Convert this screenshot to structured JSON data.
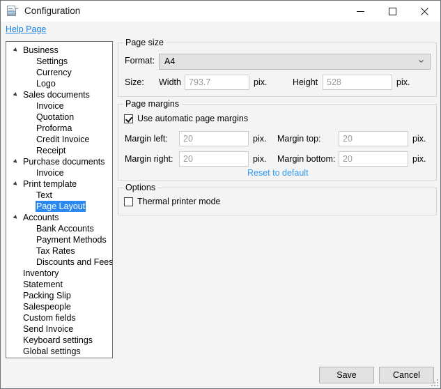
{
  "window": {
    "title": "Configuration",
    "icon": "document-spreadsheet-icon",
    "minimize_label": "Minimize",
    "maximize_label": "Maximize",
    "close_label": "Close"
  },
  "helpbar": {
    "link_label": "Help Page"
  },
  "sidebar": {
    "items": [
      {
        "label": "Business",
        "level": 0,
        "expandable": true,
        "selected": false
      },
      {
        "label": "Settings",
        "level": 1,
        "expandable": false,
        "selected": false
      },
      {
        "label": "Currency",
        "level": 1,
        "expandable": false,
        "selected": false
      },
      {
        "label": "Logo",
        "level": 1,
        "expandable": false,
        "selected": false
      },
      {
        "label": "Sales documents",
        "level": 0,
        "expandable": true,
        "selected": false
      },
      {
        "label": "Invoice",
        "level": 1,
        "expandable": false,
        "selected": false
      },
      {
        "label": "Quotation",
        "level": 1,
        "expandable": false,
        "selected": false
      },
      {
        "label": "Proforma",
        "level": 1,
        "expandable": false,
        "selected": false
      },
      {
        "label": "Credit Invoice",
        "level": 1,
        "expandable": false,
        "selected": false
      },
      {
        "label": "Receipt",
        "level": 1,
        "expandable": false,
        "selected": false
      },
      {
        "label": "Purchase documents",
        "level": 0,
        "expandable": true,
        "selected": false
      },
      {
        "label": "Invoice",
        "level": 1,
        "expandable": false,
        "selected": false
      },
      {
        "label": "Print template",
        "level": 0,
        "expandable": true,
        "selected": false
      },
      {
        "label": "Text",
        "level": 1,
        "expandable": false,
        "selected": false
      },
      {
        "label": "Page Layout",
        "level": 1,
        "expandable": false,
        "selected": true
      },
      {
        "label": "Accounts",
        "level": 0,
        "expandable": true,
        "selected": false
      },
      {
        "label": "Bank Accounts",
        "level": 1,
        "expandable": false,
        "selected": false
      },
      {
        "label": "Payment Methods",
        "level": 1,
        "expandable": false,
        "selected": false
      },
      {
        "label": "Tax Rates",
        "level": 1,
        "expandable": false,
        "selected": false
      },
      {
        "label": "Discounts and Fees",
        "level": 1,
        "expandable": false,
        "selected": false
      },
      {
        "label": "Inventory",
        "level": 0,
        "expandable": false,
        "selected": false
      },
      {
        "label": "Statement",
        "level": 0,
        "expandable": false,
        "selected": false
      },
      {
        "label": "Packing Slip",
        "level": 0,
        "expandable": false,
        "selected": false
      },
      {
        "label": "Salespeople",
        "level": 0,
        "expandable": false,
        "selected": false
      },
      {
        "label": "Custom fields",
        "level": 0,
        "expandable": false,
        "selected": false
      },
      {
        "label": "Send Invoice",
        "level": 0,
        "expandable": false,
        "selected": false
      },
      {
        "label": "Keyboard settings",
        "level": 0,
        "expandable": false,
        "selected": false
      },
      {
        "label": "Global settings",
        "level": 0,
        "expandable": false,
        "selected": false
      }
    ]
  },
  "page_size": {
    "group_title": "Page size",
    "format_label": "Format:",
    "format_value": "A4",
    "format_options": [
      "A4"
    ],
    "size_label": "Size:",
    "width_label": "Width",
    "width_value": "793.7",
    "width_unit": "pix.",
    "height_label": "Height",
    "height_value": "528",
    "height_unit": "pix."
  },
  "page_margins": {
    "group_title": "Page margins",
    "auto_checkbox_label": "Use automatic page margins",
    "auto_checkbox_checked": true,
    "margin_left_label": "Margin left:",
    "margin_left_value": "20",
    "margin_left_unit": "pix.",
    "margin_top_label": "Margin top:",
    "margin_top_value": "20",
    "margin_top_unit": "pix.",
    "margin_right_label": "Margin right:",
    "margin_right_value": "20",
    "margin_right_unit": "pix.",
    "margin_bottom_label": "Margin bottom:",
    "margin_bottom_value": "20",
    "margin_bottom_unit": "pix.",
    "reset_link_label": "Reset to default"
  },
  "options": {
    "group_title": "Options",
    "thermal_label": "Thermal printer mode",
    "thermal_checked": false
  },
  "footer": {
    "save_label": "Save",
    "cancel_label": "Cancel"
  },
  "colors": {
    "accent_link": "#1a7fe0",
    "selection_blue": "#2a8aef",
    "window_bg": "#f4f4f4",
    "panel_bg": "#ffffff"
  }
}
